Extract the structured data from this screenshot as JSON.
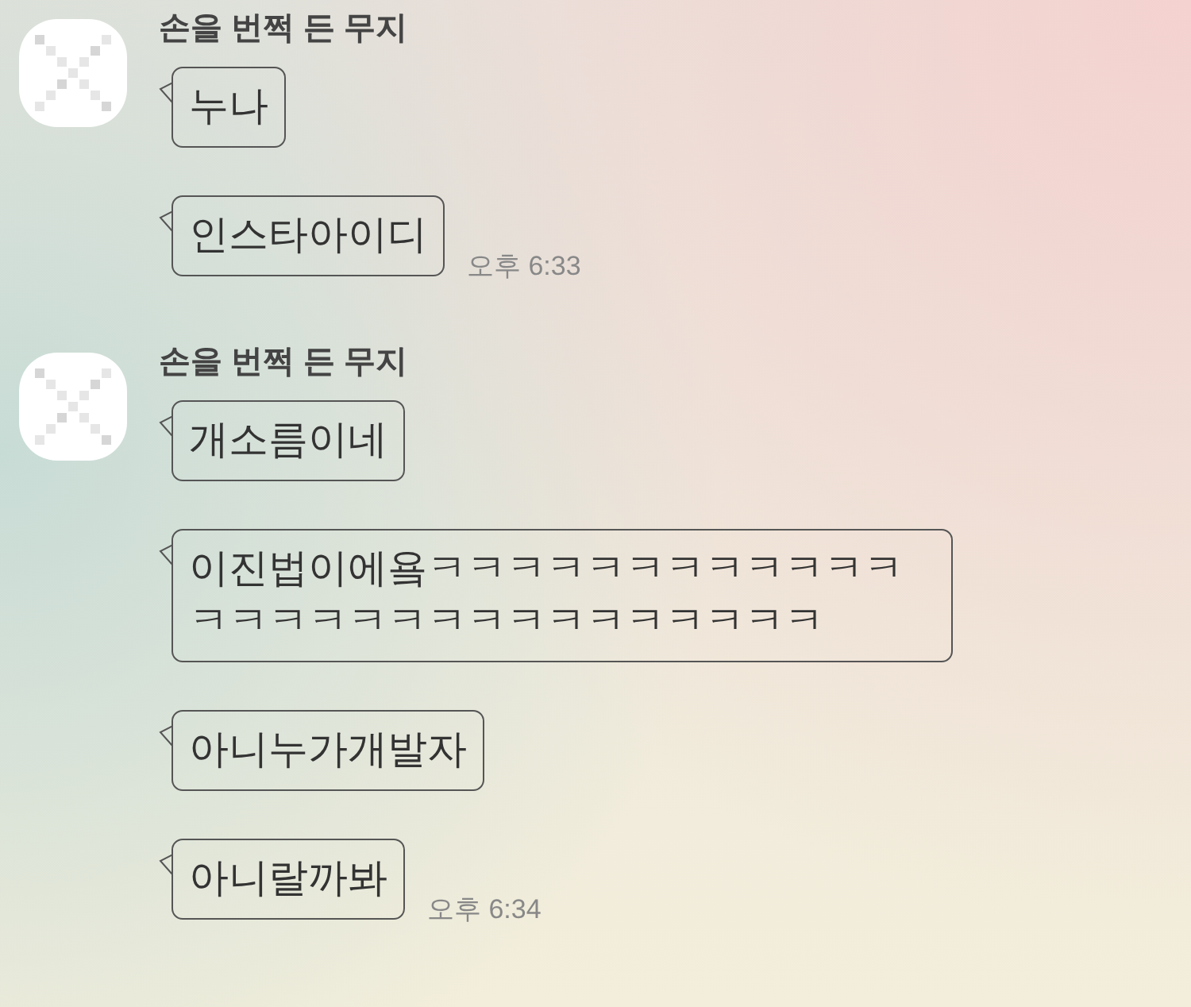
{
  "message_groups": [
    {
      "sender": "손을 번쩍 든 무지",
      "messages": [
        {
          "text": "누나"
        },
        {
          "text": "인스타아이디",
          "time": "오후 6:33"
        }
      ]
    },
    {
      "sender": "손을 번쩍 든 무지",
      "messages": [
        {
          "text": "개소름이네"
        },
        {
          "text": "이진법이에욬ㅋㅋㅋㅋㅋㅋㅋㅋㅋㅋㅋㅋㅋㅋㅋㅋㅋㅋㅋㅋㅋㅋㅋㅋㅋㅋㅋㅋ"
        },
        {
          "text": "아니누가개발자"
        },
        {
          "text": "아니랄까봐",
          "time": "오후 6:34"
        }
      ]
    }
  ]
}
